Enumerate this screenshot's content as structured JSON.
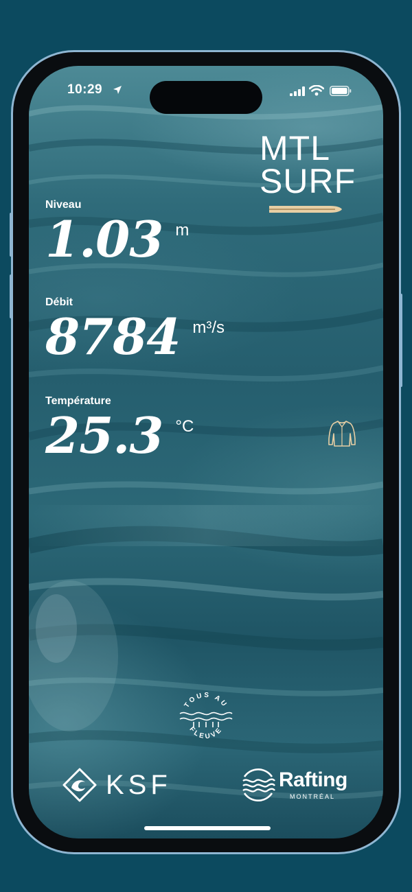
{
  "status_bar": {
    "time": "10:29"
  },
  "brand": {
    "line1": "MTL",
    "line2": "SURF",
    "accent_color": "#e8cfa4"
  },
  "metrics": {
    "niveau": {
      "label": "Niveau",
      "value": "1.03",
      "unit": "m"
    },
    "debit": {
      "label": "Débit",
      "value": "8784",
      "unit": "m³/s"
    },
    "temperature": {
      "label": "Température",
      "value": "25.3",
      "unit": "°C",
      "indicator_icon": "wetsuit-icon"
    }
  },
  "partners": {
    "tous_au_fleuve": {
      "top": "TOUS AU",
      "bottom": "FLEUVE"
    },
    "ksf": {
      "name": "KSF"
    },
    "rafting": {
      "name": "Rafting",
      "sub": "MONTRÉAL"
    }
  },
  "colors": {
    "page_bg": "#0c4a5f",
    "frame_border": "#8fb6d2",
    "text": "#ffffff",
    "accent": "#e8cfa4"
  }
}
